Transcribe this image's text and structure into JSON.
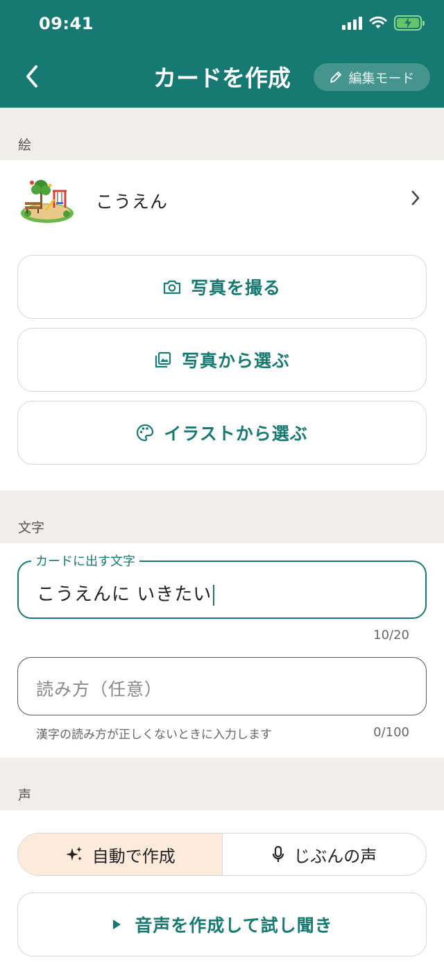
{
  "status_bar": {
    "time": "09:41"
  },
  "header": {
    "title": "カードを作成",
    "edit_mode_label": "編集モード"
  },
  "picture_section": {
    "label": "絵",
    "selected_picture": {
      "name": "こうえん",
      "icon": "park-illustration"
    },
    "buttons": {
      "take_photo": "写真を撮る",
      "choose_photo": "写真から選ぶ",
      "choose_illustration": "イラストから選ぶ"
    }
  },
  "text_section": {
    "label": "文字",
    "card_text": {
      "label": "カードに出す文字",
      "value": "こうえんに いきたい",
      "counter": "10/20"
    },
    "reading": {
      "placeholder": "読み方（任意）",
      "helper": "漢字の読み方が正しくないときに入力します",
      "counter": "0/100"
    }
  },
  "voice_section": {
    "label": "声",
    "segments": {
      "auto": "自動で作成",
      "own_voice": "じぶんの声"
    },
    "selected_segment": "auto",
    "preview_button": "音声を作成して試し聞き"
  },
  "colors": {
    "primary": "#177a72",
    "selected_segment_bg": "#fcebdb",
    "background": "#f0efeb"
  }
}
